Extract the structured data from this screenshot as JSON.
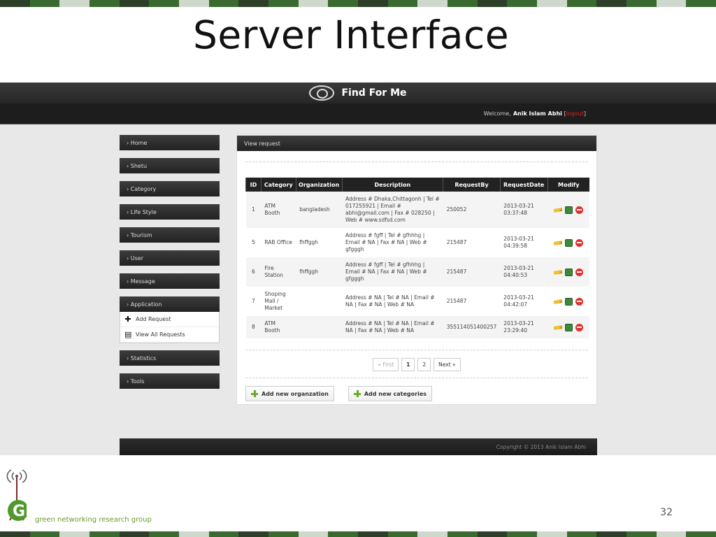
{
  "slide": {
    "title": "Server Interface",
    "page_number": "32"
  },
  "colors": {
    "stripe_dark": "#2d3f28",
    "stripe_green": "#3a6a30",
    "stripe_light": "#cfd8cc"
  },
  "app": {
    "brand": "Find For Me",
    "welcome_prefix": "Welcome,",
    "user_name": "Anik Islam Abhi",
    "logout_label": "logout",
    "footer": "Copyright © 2013 Anik Islam Abhi"
  },
  "sidebar": {
    "items": [
      "› Home",
      "› Shetu",
      "› Category",
      "› Life Style",
      "› Tourism",
      "› User",
      "› Message",
      "› Application",
      "› Statistics",
      "› Tools"
    ],
    "submenu": [
      {
        "label": "Add Request",
        "icon": "plus-icon"
      },
      {
        "label": "View All Requests",
        "icon": "document-icon"
      }
    ]
  },
  "panel": {
    "title": "View request",
    "columns": [
      "ID",
      "Category",
      "Organization",
      "Description",
      "RequestBy",
      "RequestDate",
      "Modify"
    ],
    "rows": [
      {
        "id": "1",
        "category": "ATM Booth",
        "organization": "bangladesh",
        "description": "Address # Dhaka,Chittagonh | Tel # 017255921 | Email # abhi@gmail.com | Fax # 028250 | Web # www.sdfsd.com",
        "request_by": "250052",
        "request_date": "2013-03-21 03:37:48"
      },
      {
        "id": "5",
        "category": "RAB Office",
        "organization": "fhffggh",
        "description": "Address # fgff | Tel # gfhhhg | Email # NA | Fax # NA | Web # gfgggh",
        "request_by": "215487",
        "request_date": "2013-03-21 04:39:58"
      },
      {
        "id": "6",
        "category": "Fire Station",
        "organization": "fhffggh",
        "description": "Address # fgff | Tel # gfhhhg | Email # NA | Fax # NA | Web # gfgggh",
        "request_by": "215487",
        "request_date": "2013-03-21 04:40:53"
      },
      {
        "id": "7",
        "category": "Shoping Mall / Market",
        "organization": "",
        "description": "Address # NA | Tel # NA | Email # NA | Fax # NA | Web # NA",
        "request_by": "215487",
        "request_date": "2013-03-21 04:42:07"
      },
      {
        "id": "8",
        "category": "ATM Booth",
        "organization": "",
        "description": "Address # NA | Tel # NA | Email # NA | Fax # NA | Web # NA",
        "request_by": "355114051400257",
        "request_date": "2013-03-21 23:29:40"
      }
    ],
    "pagination": {
      "first": "« First",
      "pages": [
        "1",
        "2"
      ],
      "current": "1",
      "next": "Next »"
    },
    "buttons": {
      "add_org": "Add new organzation",
      "add_cat": "Add new categories"
    }
  },
  "logo_group": {
    "name": "GNR",
    "tagline": "green networking research group"
  }
}
